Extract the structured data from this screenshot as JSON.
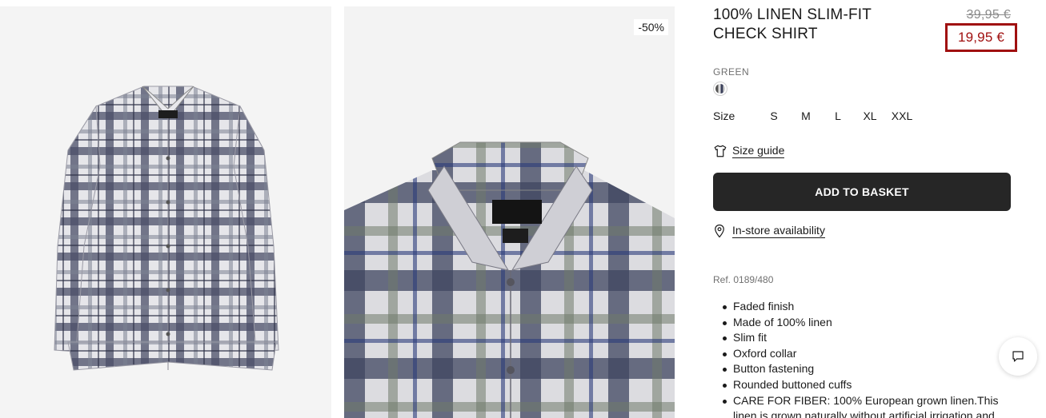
{
  "gallery": {
    "discount_badge": "-50%"
  },
  "product": {
    "title": "100% LINEN SLIM-FIT CHECK SHIRT",
    "old_price": "39,95 €",
    "new_price": "19,95 €",
    "color_label": "GREEN",
    "size_label": "Size",
    "sizes": [
      "S",
      "M",
      "L",
      "XL",
      "XXL"
    ],
    "size_guide": "Size guide",
    "add_to_basket": "ADD TO BASKET",
    "store_availability": "In-store availability",
    "reference": "Ref. 0189/480",
    "features": [
      "Faded finish",
      "Made of 100% linen",
      "Slim fit",
      "Oxford collar",
      "Button fastening",
      "Rounded buttoned cuffs",
      "CARE FOR FIBER: 100% European grown linen.This linen is grown naturally without artificial irrigation and"
    ]
  },
  "icons": {
    "size_guide": "tshirt-icon",
    "store": "location-pin-icon",
    "chat": "chat-bubble-icon"
  },
  "colors": {
    "price_accent": "#a01010",
    "button_bg": "#262626"
  }
}
